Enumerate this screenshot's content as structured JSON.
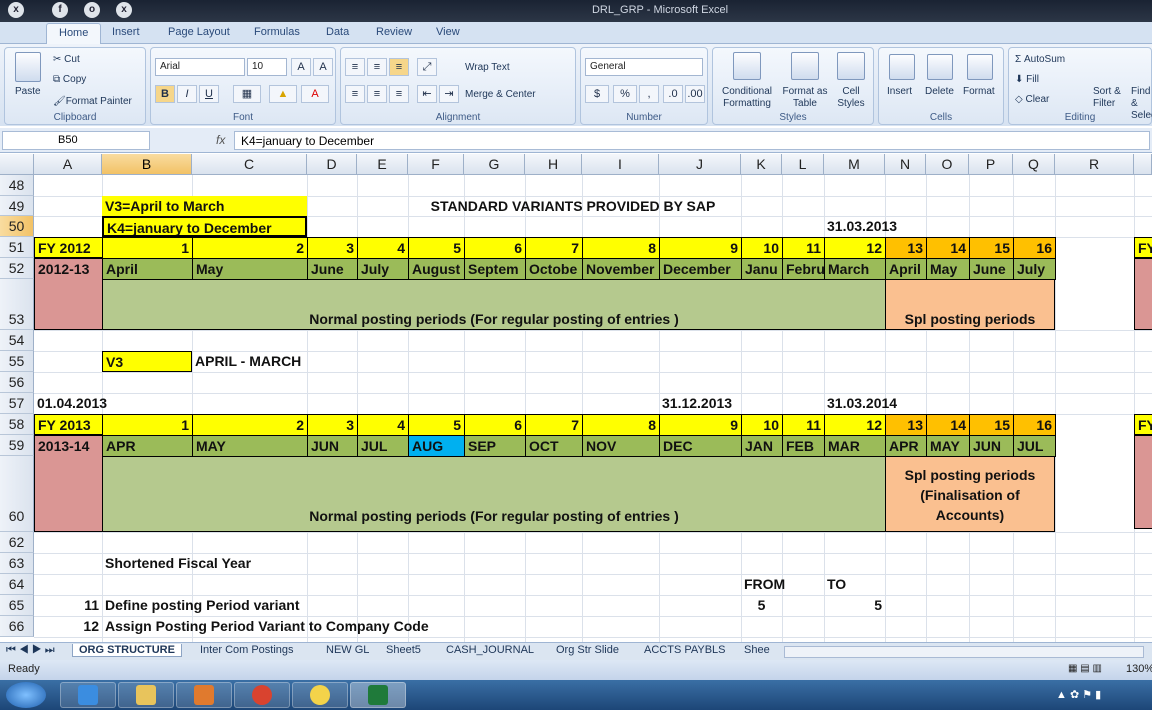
{
  "window": {
    "title": "DRL_GRP - Microsoft Excel"
  },
  "ribbon_tabs": [
    "Home",
    "Insert",
    "Page Layout",
    "Formulas",
    "Data",
    "Review",
    "View"
  ],
  "clipboard": {
    "paste": "Paste",
    "cut": "Cut",
    "copy": "Copy",
    "format_painter": "Format Painter",
    "label": "Clipboard"
  },
  "font": {
    "name": "Arial",
    "size": "10",
    "label": "Font",
    "bold": "B",
    "italic": "I",
    "underline": "U"
  },
  "alignment": {
    "wrap": "Wrap Text",
    "merge": "Merge & Center",
    "label": "Alignment"
  },
  "number": {
    "format": "General",
    "label": "Number",
    "dollar": "$",
    "percent": "%",
    "comma": ","
  },
  "styles": {
    "conditional": "Conditional Formatting",
    "table": "Format as Table",
    "cell": "Cell Styles",
    "label": "Styles"
  },
  "cells": {
    "insert": "Insert",
    "delete": "Delete",
    "format": "Format",
    "label": "Cells"
  },
  "editing": {
    "autosum": "AutoSum",
    "fill": "Fill",
    "clear": "Clear",
    "sort": "Sort & Filter",
    "find": "Find & Select",
    "label": "Editing"
  },
  "formula_bar": {
    "namebox": "B50",
    "fx": "fx",
    "content": "K4=january to December"
  },
  "columns": [
    "A",
    "B",
    "C",
    "D",
    "E",
    "F",
    "G",
    "H",
    "I",
    "J",
    "K",
    "L",
    "M",
    "N",
    "O",
    "P",
    "Q",
    "R"
  ],
  "rows": [
    "48",
    "49",
    "50",
    "51",
    "52",
    "53",
    "54",
    "55",
    "56",
    "57",
    "58",
    "59",
    "60",
    "62",
    "63",
    "64",
    "65",
    "66"
  ],
  "cells_text": {
    "b49": "V3=April to March",
    "b50": "K4=january to December",
    "f49": "STANDARD VARIANTS PROVIDED BY SAP",
    "m50": "31.03.2013",
    "a51": "FY 2012",
    "a52": "2012-13",
    "periods51": [
      "1",
      "2",
      "3",
      "4",
      "5",
      "6",
      "7",
      "8",
      "9",
      "10",
      "11",
      "12",
      "13",
      "14",
      "15",
      "16"
    ],
    "months52": [
      "April",
      "May",
      "June",
      "July",
      "August",
      "Septem",
      "Octobe",
      "November",
      "December",
      "Janu",
      "Febru",
      "March",
      "April",
      "May",
      "June",
      "July"
    ],
    "normal53": "Normal posting periods (For regular posting of entries )",
    "spl53": "Spl posting periods",
    "b55": "V3",
    "c55": "APRIL - MARCH",
    "a57": "01.04.2013",
    "j57": "31.12.2013",
    "m57": "31.03.2014",
    "a58": "FY 2013",
    "a59": "2013-14",
    "periods58": [
      "1",
      "2",
      "3",
      "4",
      "5",
      "6",
      "7",
      "8",
      "9",
      "10",
      "11",
      "12",
      "13",
      "14",
      "15",
      "16"
    ],
    "months59": [
      "APR",
      "MAY",
      "JUN",
      "JUL",
      "AUG",
      "SEP",
      "OCT",
      "NOV",
      "DEC",
      "JAN",
      "FEB",
      "MAR",
      "APR",
      "MAY",
      "JUN",
      "JUL"
    ],
    "normal60": "Normal posting periods (For regular posting of entries )",
    "spl60": "Spl posting periods (Finalisation of Accounts)",
    "b63": "Shortened Fiscal Year",
    "k64": "FROM",
    "m64": "TO",
    "a65": "11",
    "b65": "Define posting Period variant",
    "k65": "5",
    "m65": "5",
    "a66": "12",
    "b66": "Assign Posting Period Variant to Company Code",
    "r51": "FY",
    "r58": "FY"
  },
  "sheet_tabs": [
    "ORG STRUCTURE",
    "Inter Com Postings",
    "NEW GL",
    "Sheet5",
    "CASH_JOURNAL",
    "Org Str Slide",
    "ACCTS PAYBLS",
    "Shee"
  ],
  "status": {
    "ready": "Ready",
    "zoom": "130%"
  },
  "colors": {
    "yellow": "#ffff00",
    "orange": "#ffc000",
    "green": "#9bbb59",
    "pink": "#da9694",
    "peach": "#fac090",
    "blue": "#00b0f0"
  }
}
